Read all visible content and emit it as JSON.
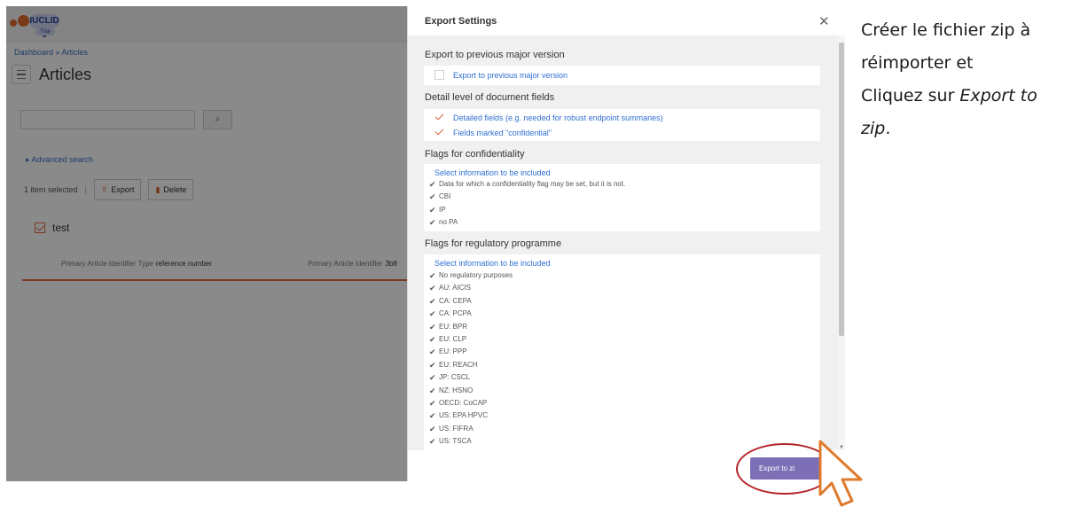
{
  "app": {
    "logo_text": "IUCLID 6",
    "logo_badge": "Trial",
    "breadcrumb": "Dashboard » Articles",
    "page_title": "Articles",
    "search_button_icon": "search-icon",
    "advanced_search": "▸ Advanced search",
    "selection_text": "1 item selected",
    "export_label": "Export",
    "delete_label": "Delete",
    "result": {
      "title": "test",
      "meta1_label": "Primary Article Identifier Type",
      "meta1_value": "reference number",
      "meta2_label": "Primary Article Identifier",
      "meta2_value": "3b8"
    }
  },
  "modal": {
    "title": "Export Settings",
    "close_icon": "close-icon",
    "sections": {
      "previous": {
        "heading": "Export to previous major version",
        "option": "Export to previous major version",
        "checked": false
      },
      "detail": {
        "heading": "Detail level of document fields",
        "options": [
          {
            "label": "Detailed fields (e.g. needed for robust endpoint summaries)",
            "checked": true
          },
          {
            "label": "Fields marked \"confidential\"",
            "checked": true
          }
        ]
      },
      "confidentiality": {
        "heading": "Flags for confidentiality",
        "select_link": "Select information to be included",
        "items": [
          "Data for which a confidentiality flag may be set, but it is not.",
          "CBI",
          "IP",
          "no PA"
        ]
      },
      "regulatory": {
        "heading": "Flags for regulatory programme",
        "select_link": "Select information to be included",
        "items": [
          "No regulatory purposes",
          "AU: AICIS",
          "CA: CEPA",
          "CA: PCPA",
          "EU: BPR",
          "EU: CLP",
          "EU: PPP",
          "EU: REACH",
          "JP: CSCL",
          "NZ: HSNO",
          "OECD: CoCAP",
          "US: EPA HPVC",
          "US: FIFRA",
          "US: TSCA"
        ]
      }
    },
    "export_button": "Export to zi",
    "check_glyph": "✔"
  },
  "instruction": {
    "line1": "Créer le fichier zip à",
    "line2": "réimporter et",
    "line3_prefix": "Cliquez sur ",
    "line3_emph": "Export to",
    "line4_emph": "zip",
    "line4_suffix": "."
  },
  "colors": {
    "accent": "#7d6fb5",
    "highlight": "#b5252a",
    "link": "#2e6fd1",
    "check_red": "#e0603a"
  }
}
